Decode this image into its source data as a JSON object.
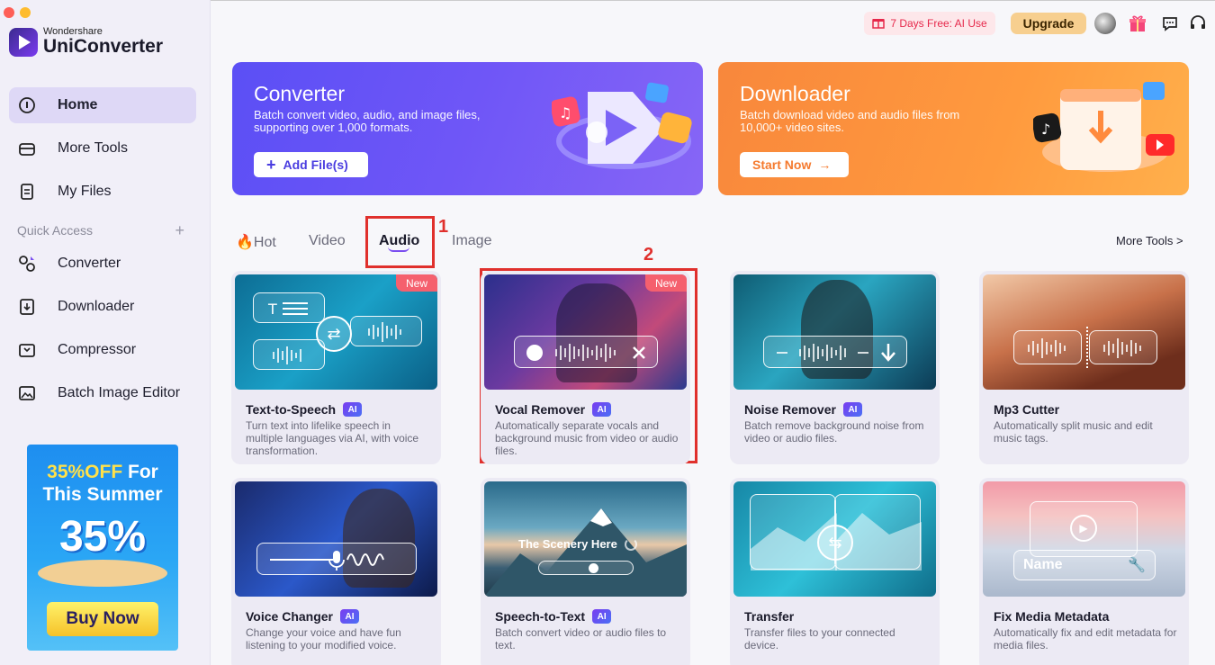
{
  "app": {
    "brand_small": "Wondershare",
    "brand_big": "UniConverter"
  },
  "sidebar": {
    "items": [
      {
        "label": "Home",
        "icon": "home-icon"
      },
      {
        "label": "More Tools",
        "icon": "toolbox-icon"
      },
      {
        "label": "My Files",
        "icon": "files-icon"
      }
    ],
    "quick_access_label": "Quick Access",
    "quick_access_plus": "+",
    "quick_items": [
      {
        "label": "Converter",
        "icon": "converter-icon"
      },
      {
        "label": "Downloader",
        "icon": "downloader-icon"
      },
      {
        "label": "Compressor",
        "icon": "compressor-icon"
      },
      {
        "label": "Batch Image Editor",
        "icon": "image-editor-icon"
      }
    ],
    "promo": {
      "line1": "35%OFF",
      "line1b": "For",
      "line2": "This Summer",
      "big": "35%",
      "button": "Buy Now"
    }
  },
  "topbar": {
    "trial_label": "7 Days Free: AI Use",
    "upgrade_label": "Upgrade"
  },
  "banners": {
    "converter": {
      "title": "Converter",
      "desc": "Batch convert video, audio, and image files, supporting over 1,000 formats.",
      "button": "Add File(s)"
    },
    "downloader": {
      "title": "Downloader",
      "desc": "Batch download video and audio files from 10,000+ video sites.",
      "button": "Start Now"
    }
  },
  "tabs": [
    {
      "label": "Hot",
      "prefix": "🔥"
    },
    {
      "label": "Video"
    },
    {
      "label": "Audio"
    },
    {
      "label": "Image"
    }
  ],
  "more_tools_link": "More Tools >",
  "annotations": [
    "1",
    "2"
  ],
  "cards": [
    {
      "title": "Text-to-Speech",
      "ai": "AI",
      "new": "New",
      "desc": "Turn text into lifelike speech in multiple languages via AI, with voice transformation."
    },
    {
      "title": "Vocal Remover",
      "ai": "AI",
      "new": "New",
      "desc": "Automatically separate vocals and background music from video or audio files."
    },
    {
      "title": "Noise Remover",
      "ai": "AI",
      "desc": "Batch remove background noise from video or audio files."
    },
    {
      "title": "Mp3 Cutter",
      "desc": "Automatically split music and edit music tags."
    },
    {
      "title": "Voice Changer",
      "ai": "AI",
      "desc": "Change your voice and have fun listening to your modified voice."
    },
    {
      "title": "Speech-to-Text",
      "ai": "AI",
      "desc": "Batch convert video or audio files to text.",
      "overlay": "The Scenery Here"
    },
    {
      "title": "Transfer",
      "desc": "Transfer files to your connected device."
    },
    {
      "title": "Fix Media Metadata",
      "desc": "Automatically fix and edit metadata for media files.",
      "overlay": "Name"
    }
  ],
  "colors": {
    "accent": "#7a4df0",
    "annotation": "#e0302c",
    "new_badge": "#f5606e"
  }
}
